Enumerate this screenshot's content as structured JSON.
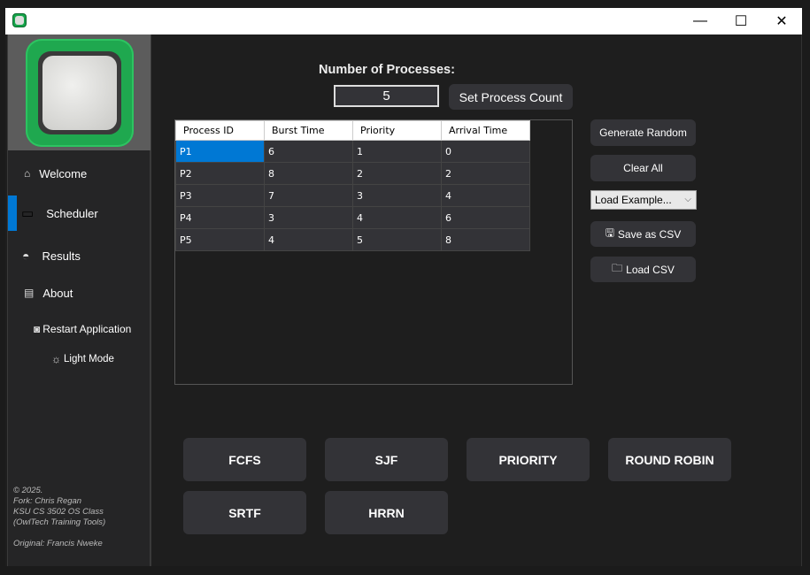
{
  "window": {
    "controls": {
      "minimize": "—",
      "maximize": "☐",
      "close": "✕"
    }
  },
  "sidebar": {
    "items": [
      {
        "label": "Welcome",
        "icon": "home-icon",
        "glyph": "⌂"
      },
      {
        "label": "Scheduler",
        "icon": "monitor-icon",
        "glyph": "▭"
      },
      {
        "label": "Results",
        "icon": "gauge-icon",
        "glyph": "◓"
      },
      {
        "label": "About",
        "icon": "document-icon",
        "glyph": "▤"
      }
    ],
    "selected": "Scheduler",
    "restart": {
      "label": "Restart Application",
      "glyph": "◙"
    },
    "light_mode": {
      "label": "Light Mode",
      "glyph": "☼"
    },
    "credits": [
      "© 2025.",
      "Fork: Chris Regan",
      "KSU CS 3502 OS Class",
      "(OwlTech Training Tools)",
      "",
      "Original: Francis Nweke"
    ]
  },
  "main": {
    "count_label": "Number of Processes:",
    "count_value": "5",
    "set_count": "Set Process Count",
    "table": {
      "headers": [
        "Process ID",
        "Burst Time",
        "Priority",
        "Arrival Time"
      ],
      "rows": [
        [
          "P1",
          "6",
          "1",
          "0"
        ],
        [
          "P2",
          "8",
          "2",
          "2"
        ],
        [
          "P3",
          "7",
          "3",
          "4"
        ],
        [
          "P4",
          "3",
          "4",
          "6"
        ],
        [
          "P5",
          "4",
          "5",
          "8"
        ]
      ]
    },
    "actions": {
      "generate": "Generate Random",
      "clear": "Clear All",
      "example": "Load Example...",
      "save": "Save as CSV",
      "save_glyph": "🖫",
      "load": "Load CSV",
      "load_glyph": "🗀"
    },
    "algorithms": [
      "FCFS",
      "SJF",
      "PRIORITY",
      "ROUND ROBIN",
      "SRTF",
      "HRRN"
    ]
  },
  "colors": {
    "accent": "#0078d4",
    "background": "#1e1e1e",
    "button": "#333337"
  }
}
